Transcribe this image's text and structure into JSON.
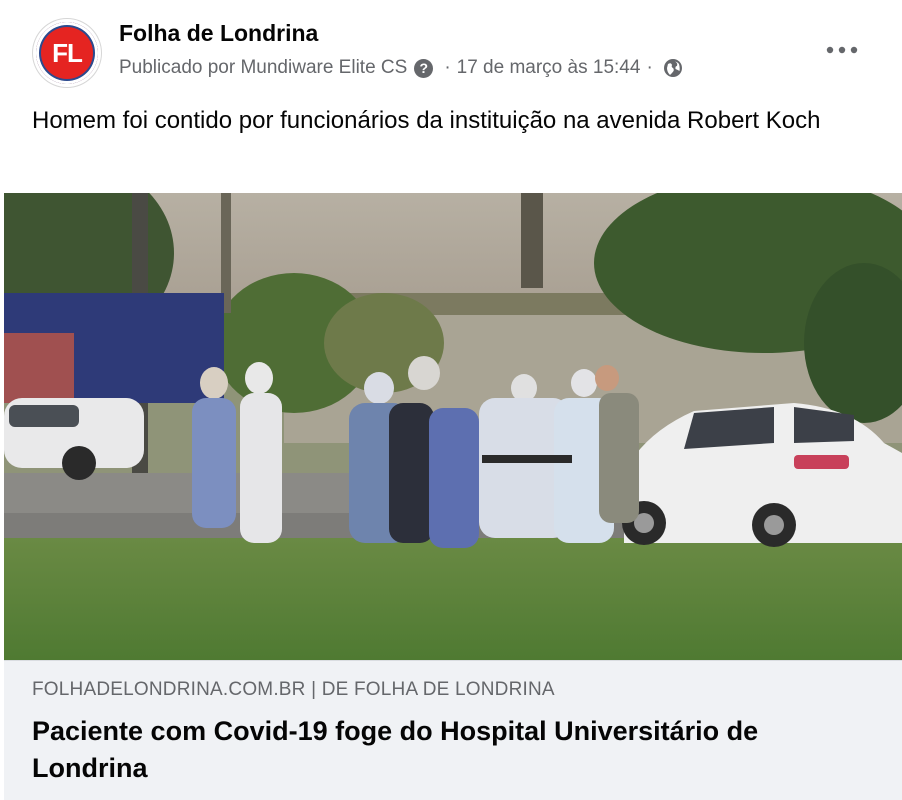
{
  "post": {
    "page_name": "Folha de Londrina",
    "avatar_text": "FL",
    "published_by": "Publicado por Mundiware Elite CS",
    "question_icon": "question-icon",
    "separator": "·",
    "timestamp": "17 de março às 15:44",
    "audience_icon": "globe-icon",
    "more_icon": "more-horizontal-icon",
    "caption": "Homem foi contido por funcionários da instituição na avenida Robert Koch"
  },
  "link_preview": {
    "domain": "FOLHADELONDRINA.COM.BR | DE FOLHA DE LONDRINA",
    "title": "Paciente com Covid-19 foge do Hospital Universitário de Londrina"
  },
  "colors": {
    "brand_red": "#e52421",
    "brand_blue": "#2c4a8e",
    "secondary_text": "#65676b",
    "preview_bg": "#f0f2f5"
  }
}
